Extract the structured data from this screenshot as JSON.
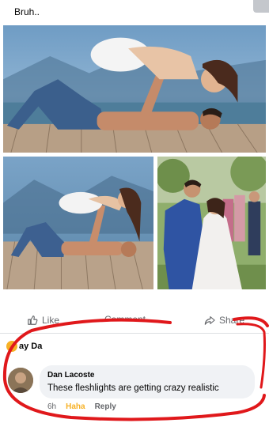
{
  "post": {
    "text": "Bruh.."
  },
  "photos": [
    {
      "name": "couple-on-dock-wide"
    },
    {
      "name": "couple-on-dock-side"
    },
    {
      "name": "wedding-couple"
    }
  ],
  "actions": {
    "like_label": "Like",
    "comment_label": "Comment",
    "share_label": "Share"
  },
  "reactions": {
    "reactor_name": "ay Da",
    "emoji": "haha"
  },
  "comment": {
    "author": "Dan Lacoste",
    "text": "These fleshlights are getting crazy realistic",
    "time": "6h",
    "reaction_label": "Haha",
    "reply_label": "Reply"
  },
  "colors": {
    "annotation_red": "#e0181b",
    "haha": "#f7b125",
    "bubble_bg": "#f0f2f5"
  }
}
